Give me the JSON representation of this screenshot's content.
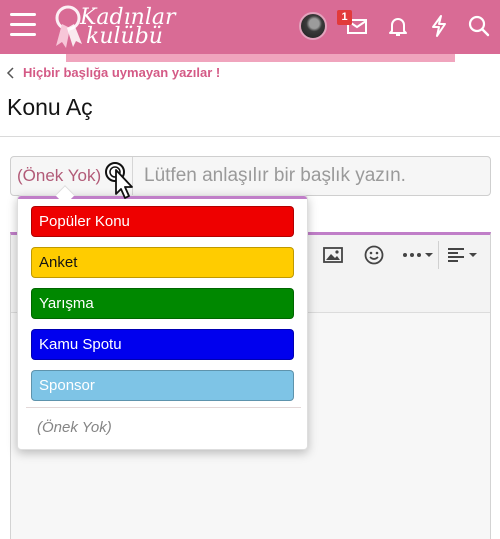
{
  "header": {
    "logo_line1": "Kadınlar",
    "logo_line2": "kulübü",
    "notification_count": "1",
    "icons": [
      "menu-icon",
      "avatar",
      "envelope-icon",
      "bell-icon",
      "lightning-icon",
      "search-icon"
    ],
    "colors": {
      "bar": "#d96b95",
      "accent": "#f0a4bd"
    }
  },
  "breadcrumb": {
    "label": "Hiçbir başlığa uymayan yazılar !"
  },
  "page": {
    "title": "Konu Aç"
  },
  "form": {
    "prefix_value": "(Önek Yok)",
    "title_placeholder": "Lütfen anlaşılır bir başlık yazın."
  },
  "prefix_menu": {
    "items": [
      {
        "label": "Popüler Konu",
        "bg": "#ee0000",
        "fg": "#ffffff"
      },
      {
        "label": "Anket",
        "bg": "#ffcc00",
        "fg": "#141414"
      },
      {
        "label": "Yarışma",
        "bg": "#008800",
        "fg": "#ffffff"
      },
      {
        "label": "Kamu Spotu",
        "bg": "#0000ee",
        "fg": "#ffffff"
      },
      {
        "label": "Sponsor",
        "bg": "#7ec4e6",
        "fg": "#ffffff"
      }
    ],
    "none_label": "(Önek Yok)"
  },
  "editor": {
    "toolbar_icons": [
      "image-icon",
      "smiley-icon",
      "more-icon",
      "align-icon"
    ]
  }
}
